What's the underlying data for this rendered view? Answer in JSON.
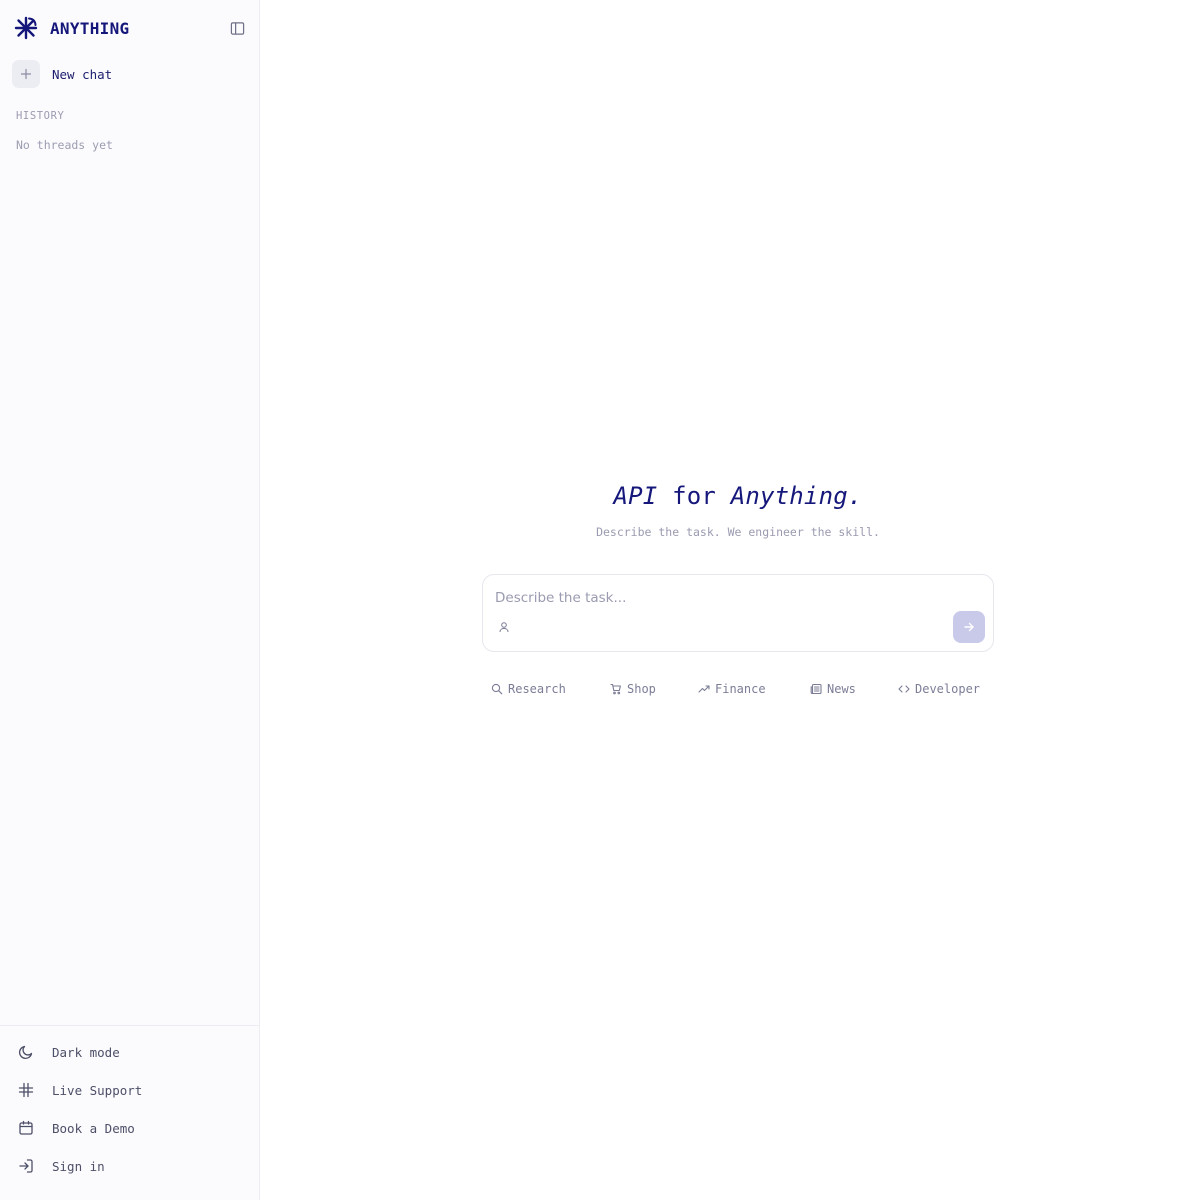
{
  "sidebar": {
    "brand_name": "ANYTHING",
    "new_chat_label": "New chat",
    "history_title": "HISTORY",
    "history_empty": "No threads yet",
    "footer_items": [
      {
        "label": "Dark mode",
        "icon": "moon-icon"
      },
      {
        "label": "Live Support",
        "icon": "slack-icon"
      },
      {
        "label": "Book a Demo",
        "icon": "calendar-icon"
      },
      {
        "label": "Sign in",
        "icon": "sign-in-icon"
      }
    ]
  },
  "main": {
    "title_part1": "API",
    "title_part2": "for",
    "title_part3": "Anything.",
    "subtitle": "Describe the task. We engineer the skill.",
    "composer": {
      "placeholder": "Describe the task..."
    },
    "chips": [
      {
        "label": "Research",
        "icon": "search-icon"
      },
      {
        "label": "Shop",
        "icon": "cart-icon"
      },
      {
        "label": "Finance",
        "icon": "trending-up-icon"
      },
      {
        "label": "News",
        "icon": "newspaper-icon"
      },
      {
        "label": "Developer",
        "icon": "code-icon"
      }
    ]
  },
  "colors": {
    "brand": "#14167a",
    "accent_send_disabled": "#c9c9ea",
    "muted_text": "#9a9bb0",
    "sidebar_bg": "#fbfbfd"
  }
}
